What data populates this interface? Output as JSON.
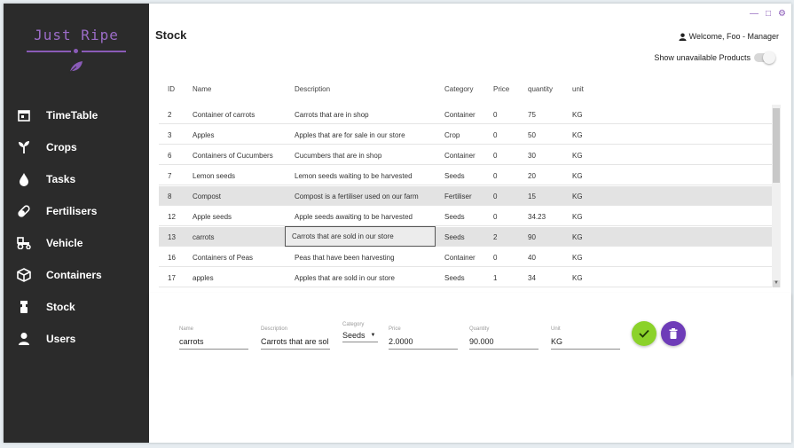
{
  "app": {
    "logo_text": "Just Ripe",
    "page_title": "Stock",
    "welcome": "Welcome, Foo - Manager",
    "show_unavailable_label": "Show unavailable Products",
    "window_controls": [
      "minimize-icon",
      "maximize-icon",
      "settings-icon"
    ]
  },
  "sidebar": {
    "items": [
      {
        "label": "TimeTable",
        "icon": "calendar-icon"
      },
      {
        "label": "Crops",
        "icon": "sprout-icon"
      },
      {
        "label": "Tasks",
        "icon": "drop-icon"
      },
      {
        "label": "Fertilisers",
        "icon": "pill-icon"
      },
      {
        "label": "Vehicle",
        "icon": "tractor-icon"
      },
      {
        "label": "Containers",
        "icon": "box-icon"
      },
      {
        "label": "Stock",
        "icon": "stock-icon"
      },
      {
        "label": "Users",
        "icon": "user-icon"
      }
    ]
  },
  "table": {
    "headers": [
      "ID",
      "Name",
      "Description",
      "Category",
      "Price",
      "quantity",
      "unit"
    ],
    "rows": [
      [
        "2",
        "Container of carrots",
        "Carrots that are in shop",
        "Container",
        "0",
        "75",
        "KG"
      ],
      [
        "3",
        "Apples",
        "Apples that are for sale in our store",
        "Crop",
        "0",
        "50",
        "KG"
      ],
      [
        "6",
        "Containers of Cucumbers",
        "Cucumbers that are in shop",
        "Container",
        "0",
        "30",
        "KG"
      ],
      [
        "7",
        "Lemon seeds",
        "Lemon seeds waiting to be harvested",
        "Seeds",
        "0",
        "20",
        "KG"
      ],
      [
        "8",
        "Compost",
        "Compost is a fertiliser used on our farm",
        "Fertiliser",
        "0",
        "15",
        "KG"
      ],
      [
        "12",
        "Apple seeds",
        "Apple seeds awaiting to be harvested",
        "Seeds",
        "0",
        "34.23",
        "KG"
      ],
      [
        "13",
        "carrots",
        "Carrots that are sold in our store",
        "Seeds",
        "2",
        "90",
        "KG"
      ],
      [
        "16",
        "Containers of Peas",
        "Peas that have been harvesting",
        "Container",
        "0",
        "40",
        "KG"
      ],
      [
        "17",
        "apples",
        "Apples that are sold in our store",
        "Seeds",
        "1",
        "34",
        "KG"
      ]
    ]
  },
  "form": {
    "name_label": "Name",
    "name_value": "carrots",
    "description_label": "Description",
    "description_value": "Carrots that are sol",
    "category_label": "Category",
    "category_value": "Seeds",
    "price_label": "Price",
    "price_value": "2.0000",
    "quantity_label": "Quantity",
    "quantity_value": "90.000",
    "unit_label": "Unit",
    "unit_value": "KG"
  },
  "colors": {
    "sidebar_bg": "#2b2b2b",
    "accent_purple": "#6e3cb8",
    "accent_green": "#8bd22a",
    "highlight_row": "#e3e3e3"
  }
}
